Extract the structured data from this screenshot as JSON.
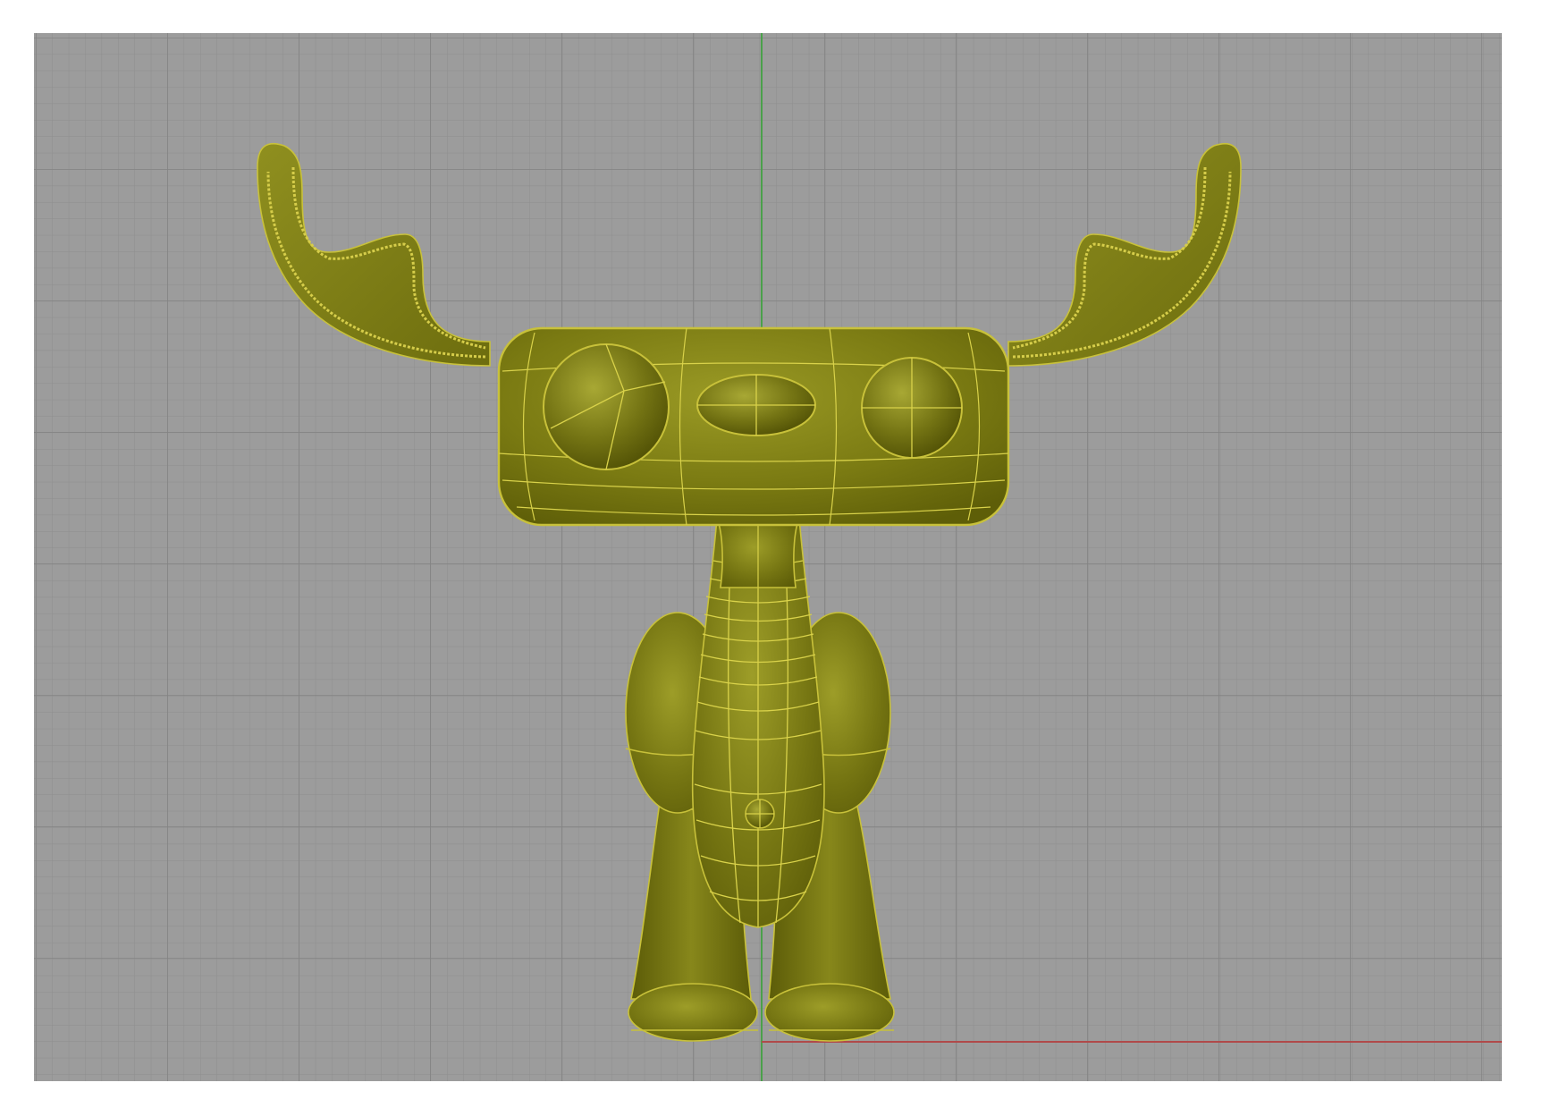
{
  "viewport": {
    "label": "",
    "model_name": "moose-character",
    "background_color": "#9c9c9c",
    "minor_grid_color": "#8e8e8e",
    "major_grid_color": "#828282",
    "x_axis_color": "#b04a4a",
    "y_axis_color": "#4aa04a",
    "model_color": "#7a7a10",
    "model_highlight_color": "#b5b531",
    "isocurve_color": "#d9d24a"
  }
}
